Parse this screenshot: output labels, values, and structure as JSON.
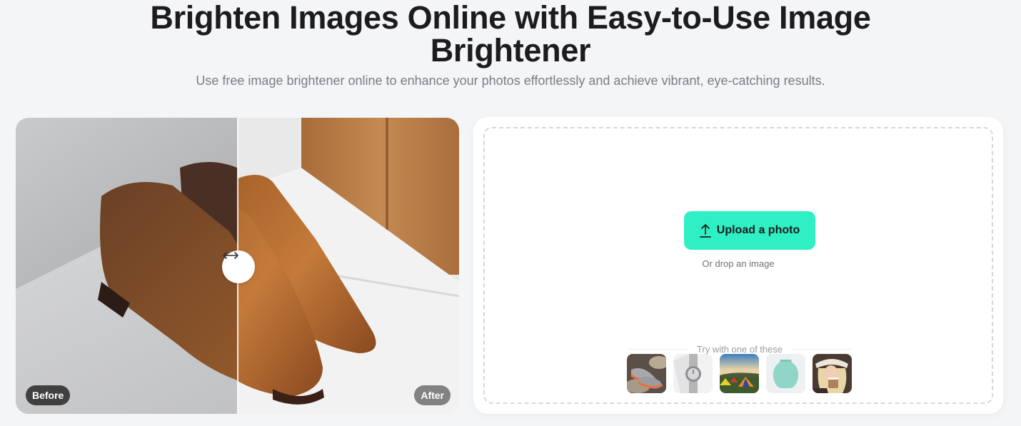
{
  "hero": {
    "title": "Brighten Images Online with Easy-to-Use Image Brightener",
    "subtitle": "Use free image brightener online to enhance your photos effortlessly and achieve vibrant, eye-catching results."
  },
  "compare": {
    "before_label": "Before",
    "after_label": "After",
    "handle_icon": "left-right-arrow-icon",
    "slider_position": 0.5
  },
  "upload": {
    "button_label": "Upload a photo",
    "button_icon": "upload-arrow-icon",
    "drop_hint": "Or drop an image",
    "accent_color": "#2ef0c4",
    "samples_label": "Try with one of these",
    "samples": [
      {
        "name": "sneakers"
      },
      {
        "name": "watch"
      },
      {
        "name": "camping-tents"
      },
      {
        "name": "vase"
      },
      {
        "name": "woman-with-coffee"
      }
    ]
  }
}
